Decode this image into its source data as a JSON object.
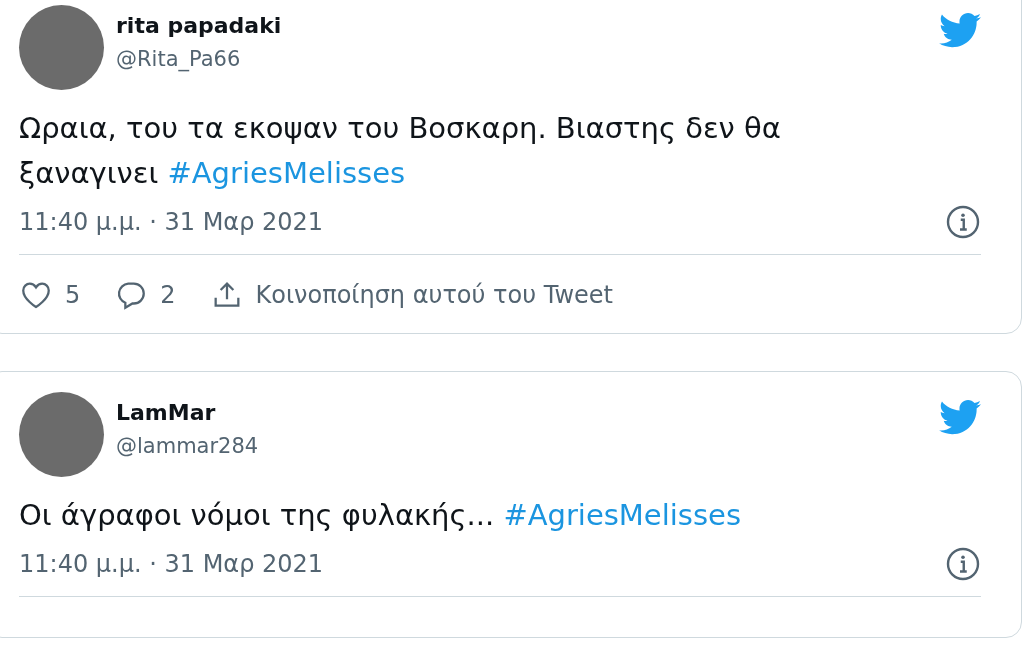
{
  "tweets": [
    {
      "name": "rita papadaki",
      "handle": "@Rita_Pa66",
      "text": "Ωραια, του τα εκοψαν του Βοσκαρη. Βιαστης δεν θα ξαναγινει",
      "hashtag": "#AgriesMelisses",
      "time": "11:40 μ.μ. · 31 Μαρ 2021",
      "actions": {
        "likes": "5",
        "replies": "2",
        "share": "Κοινοποίηση αυτού του Tweet"
      }
    },
    {
      "name": "LamMar",
      "handle": "@lammar284",
      "text": "Οι άγραφοι νόμοι της φυλακής...",
      "hashtag": "#AgriesMelisses",
      "time": "11:40 μ.μ. · 31 Μαρ 2021"
    }
  ]
}
